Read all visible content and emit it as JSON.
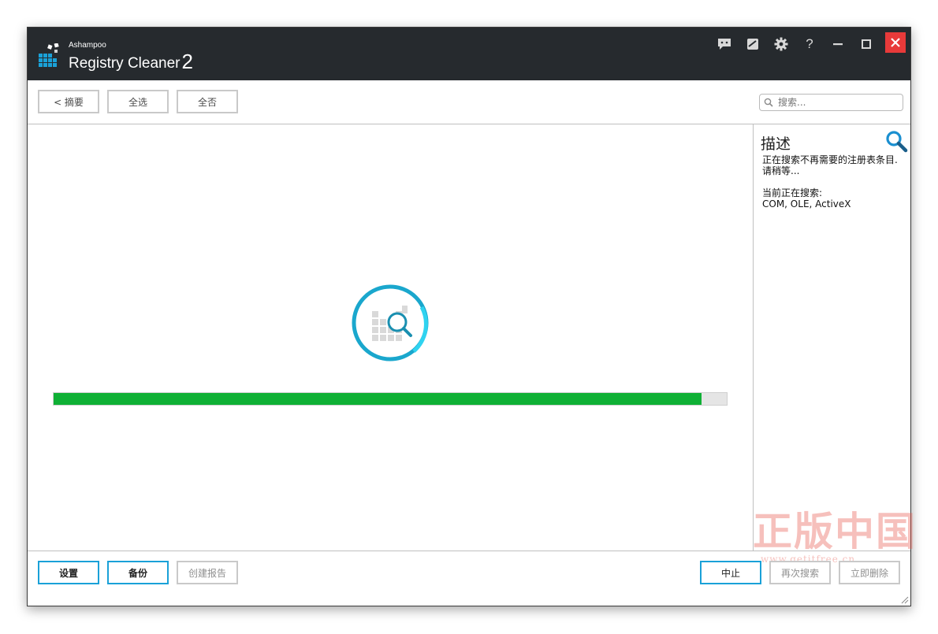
{
  "app": {
    "brand": "Ashampoo",
    "product": "Registry Cleaner",
    "version": "2"
  },
  "titlebar_icons": [
    "feedback-icon",
    "edit-icon",
    "settings-gear-icon",
    "help-icon",
    "minimize-icon",
    "maximize-icon",
    "close-icon"
  ],
  "titlebar": {
    "help_label": "?"
  },
  "toolbar": {
    "back_label": "< 摘要",
    "select_all_label": "全选",
    "select_none_label": "全否",
    "search_placeholder": "搜索..."
  },
  "sidebar": {
    "title": "描述",
    "line1": "正在搜索不再需要的注册表条目.",
    "line2": "请稍等...",
    "current_label": "当前正在搜索:",
    "current_value": "COM, OLE, ActiveX"
  },
  "scan": {
    "progress": 0.963,
    "colors": {
      "progress_fill": "#0fb035",
      "ring": "#1aa7cd",
      "accent": "#1aa1d8",
      "close": "#e83a3a"
    }
  },
  "bottom": {
    "settings_label": "设置",
    "backup_label": "备份",
    "report_label": "创建报告",
    "stop_label": "中止",
    "rescan_label": "再次搜索",
    "delete_label": "立即删除"
  },
  "watermark": {
    "big": "正版中国",
    "small": "www.getitfree.cn"
  }
}
